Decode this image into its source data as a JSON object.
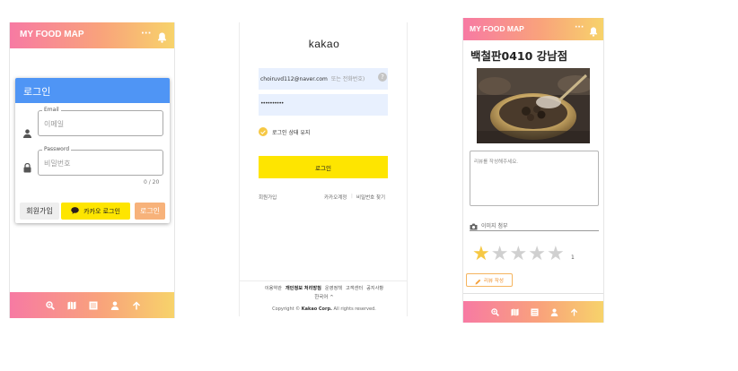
{
  "colors": {
    "gradient_start": "#f77aa3",
    "gradient_end": "#f7d46a",
    "login_header_blue": "#4f95f5",
    "kakao_yellow": "#fee500",
    "input_autofill": "#e8f0fe",
    "star_filled": "#f6c844",
    "star_empty": "#d0d0d0"
  },
  "screen1": {
    "app_title": "MY FOOD MAP",
    "header_icons": [
      "more-icon",
      "bell-icon"
    ],
    "login": {
      "title": "로그인",
      "email_label": "Email",
      "email_placeholder": "이메일",
      "password_label": "Password",
      "password_placeholder": "비밀번호",
      "password_counter": "0 / 20",
      "signup_button": "회원가입",
      "kakao_button": "카카오 로그인",
      "login_button": "로그인"
    },
    "footer_icons": [
      "search-icon",
      "map-icon",
      "list-icon",
      "user-icon",
      "arrow-up-icon"
    ]
  },
  "screen2": {
    "logo": "kakao",
    "id_value": "choiruvd112@naver.com",
    "id_placeholder_tail": "또는 전화번호)",
    "password_value": "••••••••••",
    "keep_login": "로그인 상태 유지",
    "login_button": "로그인",
    "signup_link": "회원가입",
    "find_account": "카카오계정",
    "find_password": "비밀번호 찾기",
    "footer_links": [
      "이용약관",
      "개인정보 처리방침",
      "운영정책",
      "고객센터",
      "공지사항"
    ],
    "language": "한국어 ^",
    "copyright_prefix": "Copyright ©",
    "copyright_company": "Kakao Corp.",
    "copyright_suffix": "All rights reserved."
  },
  "screen3": {
    "app_title": "MY FOOD MAP",
    "restaurant_name": "백철판0410 강남점",
    "review_placeholder": "리뷰를 작성해주세요.",
    "image_attach": "이미지 첨부",
    "rating": 1,
    "rating_max": 5,
    "rating_text": "1",
    "write_review_button": "리뷰 작성",
    "footer_icons": [
      "search-icon",
      "map-icon",
      "list-icon",
      "user-icon",
      "arrow-up-icon"
    ]
  }
}
